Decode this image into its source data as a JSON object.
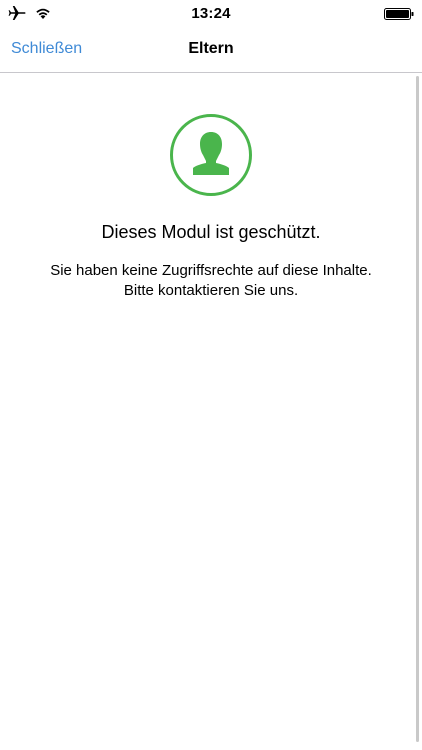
{
  "status_bar": {
    "time": "13:24",
    "icons": [
      "airplane-icon",
      "wifi-icon",
      "battery-icon"
    ]
  },
  "nav": {
    "back_label": "Schließen",
    "title": "Eltern"
  },
  "content": {
    "icon": "user-silhouette-icon",
    "heading": "Dieses Modul ist geschützt.",
    "message_line1": "Sie haben keine Zugriffsrechte auf diese Inhalte.",
    "message_line2": "Bitte kontaktieren Sie uns."
  },
  "colors": {
    "accent": "#3f8ad6",
    "brand_green": "#4ab54c"
  }
}
